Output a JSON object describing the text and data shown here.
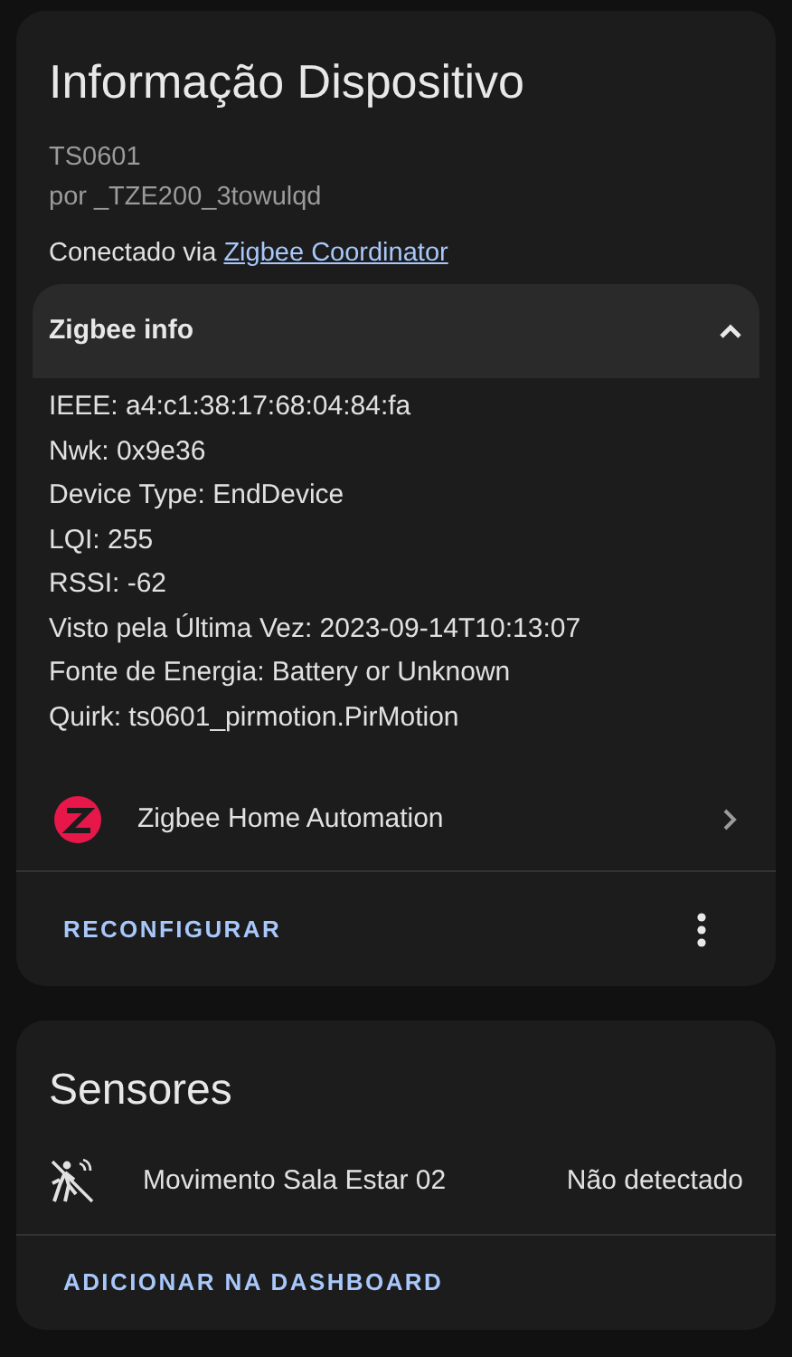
{
  "device_card": {
    "title": "Informação Dispositivo",
    "model": "TS0601",
    "manufacturer": "por _TZE200_3towulqd",
    "connection": {
      "prefix": "Conectado via",
      "link": "Zigbee Coordinator"
    },
    "zigbee_info": {
      "title": "Zigbee info",
      "expanded": true,
      "lines": [
        "IEEE: a4:c1:38:17:68:04:84:fa",
        "Nwk: 0x9e36",
        "Device Type: EndDevice",
        "LQI: 255",
        "RSSI: -62",
        "Visto pela Última Vez: 2023-09-14T10:13:07",
        "Fonte de Energia: Battery or Unknown",
        "Quirk: ts0601_pirmotion.PirMotion"
      ]
    },
    "integration": {
      "name": "Zigbee Home Automation"
    },
    "action": "RECONFIGURAR"
  },
  "sensors_card": {
    "title": "Sensores",
    "entities": [
      {
        "name": "Movimento Sala Estar 02",
        "state": "Não detectado"
      }
    ],
    "action": "ADICIONAR NA DASHBOARD"
  }
}
